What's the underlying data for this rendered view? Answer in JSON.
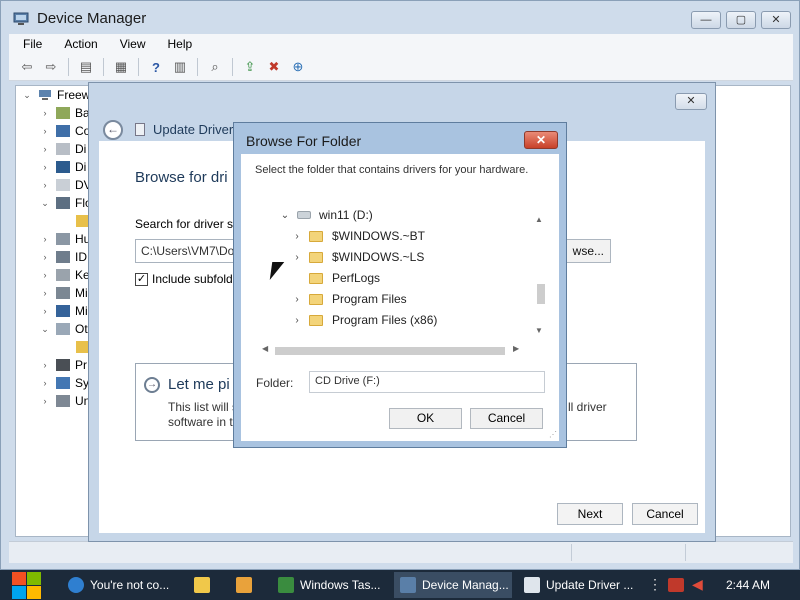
{
  "device_manager": {
    "title": "Device Manager",
    "menu": [
      "File",
      "Action",
      "View",
      "Help"
    ],
    "tree": [
      {
        "label": "Freew",
        "expanded": true
      },
      {
        "label": "Ba"
      },
      {
        "label": "Co"
      },
      {
        "label": "Di"
      },
      {
        "label": "Di"
      },
      {
        "label": "DV"
      },
      {
        "label": "Flo",
        "expanded": true
      },
      {
        "label": "Hu"
      },
      {
        "label": "ID"
      },
      {
        "label": "Ke"
      },
      {
        "label": "Mi"
      },
      {
        "label": "Mi"
      },
      {
        "label": "Ot",
        "expanded": true
      },
      {
        "label": "Pr"
      },
      {
        "label": "Sy"
      },
      {
        "label": "Un"
      }
    ]
  },
  "update_driver": {
    "title": "Update Driver S",
    "heading": "Browse for dri",
    "search_label": "Search for driver so",
    "path_value": "C:\\Users\\VM7\\Do",
    "browse_label": "wse...",
    "include_subfolders_label": "Include subfold",
    "include_subfolders_checked": true,
    "let_me_title": "Let me pi",
    "let_me_line1": "This list will s",
    "let_me_line2": "software in t",
    "let_me_right": "ll driver",
    "next_label": "Next",
    "cancel_label": "Cancel"
  },
  "browse_folder": {
    "title": "Browse For Folder",
    "close_label": "✕",
    "description": "Select the folder that contains drivers for your hardware.",
    "tree": [
      {
        "label": "win11 (D:)",
        "kind": "drive",
        "expanded": true
      },
      {
        "label": "$WINDOWS.~BT",
        "kind": "folder",
        "expandable": true
      },
      {
        "label": "$WINDOWS.~LS",
        "kind": "folder",
        "expandable": true
      },
      {
        "label": "PerfLogs",
        "kind": "folder",
        "expandable": false
      },
      {
        "label": "Program Files",
        "kind": "folder",
        "expandable": true
      },
      {
        "label": "Program Files (x86)",
        "kind": "folder",
        "expandable": true
      }
    ],
    "folder_label": "Folder:",
    "folder_value": "CD Drive (F:)",
    "ok_label": "OK",
    "cancel_label": "Cancel"
  },
  "taskbar": {
    "items": [
      {
        "label": "You're not co...",
        "icon": "ie-icon"
      },
      {
        "label": "",
        "icon": "folder-icon"
      },
      {
        "label": "",
        "icon": "media-icon"
      },
      {
        "label": "Windows Tas...",
        "icon": "task-manager-icon"
      },
      {
        "label": "Device Manag...",
        "icon": "device-manager-icon",
        "active": true
      },
      {
        "label": "Update Driver ...",
        "icon": "update-driver-icon"
      }
    ],
    "clock": "2:44 AM"
  },
  "colors": {
    "folder": "#f3d47a",
    "close_red": "#c84129",
    "taskbar": "#1c2a3a"
  }
}
